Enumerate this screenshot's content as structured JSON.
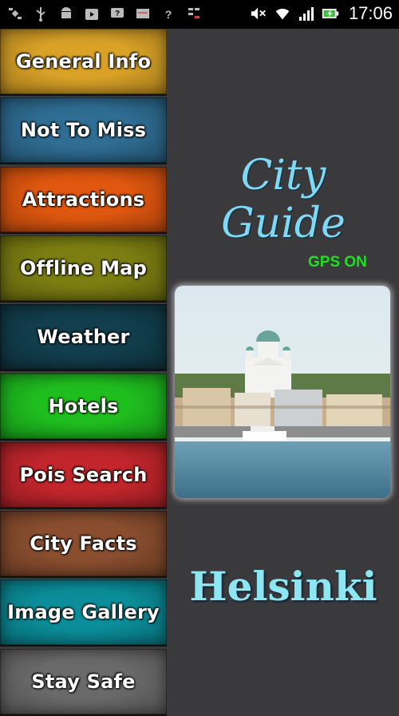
{
  "status_bar": {
    "time": "17:06",
    "left_icons": [
      "satellite-icon",
      "usb-icon",
      "android-icon",
      "play-store-icon",
      "help-box-icon",
      "storage-icon",
      "wifi-question-icon",
      "signal-swap-icon"
    ],
    "right_icons": [
      "mute-icon",
      "wifi-icon",
      "cell-signal-icon",
      "battery-charging-icon"
    ]
  },
  "menu": [
    {
      "label": "General Info",
      "color": "#d9a227"
    },
    {
      "label": "Not To Miss",
      "color": "#2f6d93"
    },
    {
      "label": "Attractions",
      "color": "#e0570f"
    },
    {
      "label": "Offline Map",
      "color": "#7c7e12"
    },
    {
      "label": "Weather",
      "color": "#123e4d"
    },
    {
      "label": "Hotels",
      "color": "#1fbe1f"
    },
    {
      "label": "Pois Search",
      "color": "#c2262c"
    },
    {
      "label": "City Facts",
      "color": "#8a4e2f"
    },
    {
      "label": "Image Gallery",
      "color": "#0b8e9a"
    },
    {
      "label": "Stay Safe",
      "color": "#6a6a6a"
    }
  ],
  "main": {
    "title": "City Guide",
    "gps_status": "GPS ON",
    "city": "Helsinki"
  },
  "colors": {
    "background": "#3a3a3d",
    "title": "#7fd8f5",
    "gps": "#1fe01f",
    "city": "#8de7f2"
  }
}
